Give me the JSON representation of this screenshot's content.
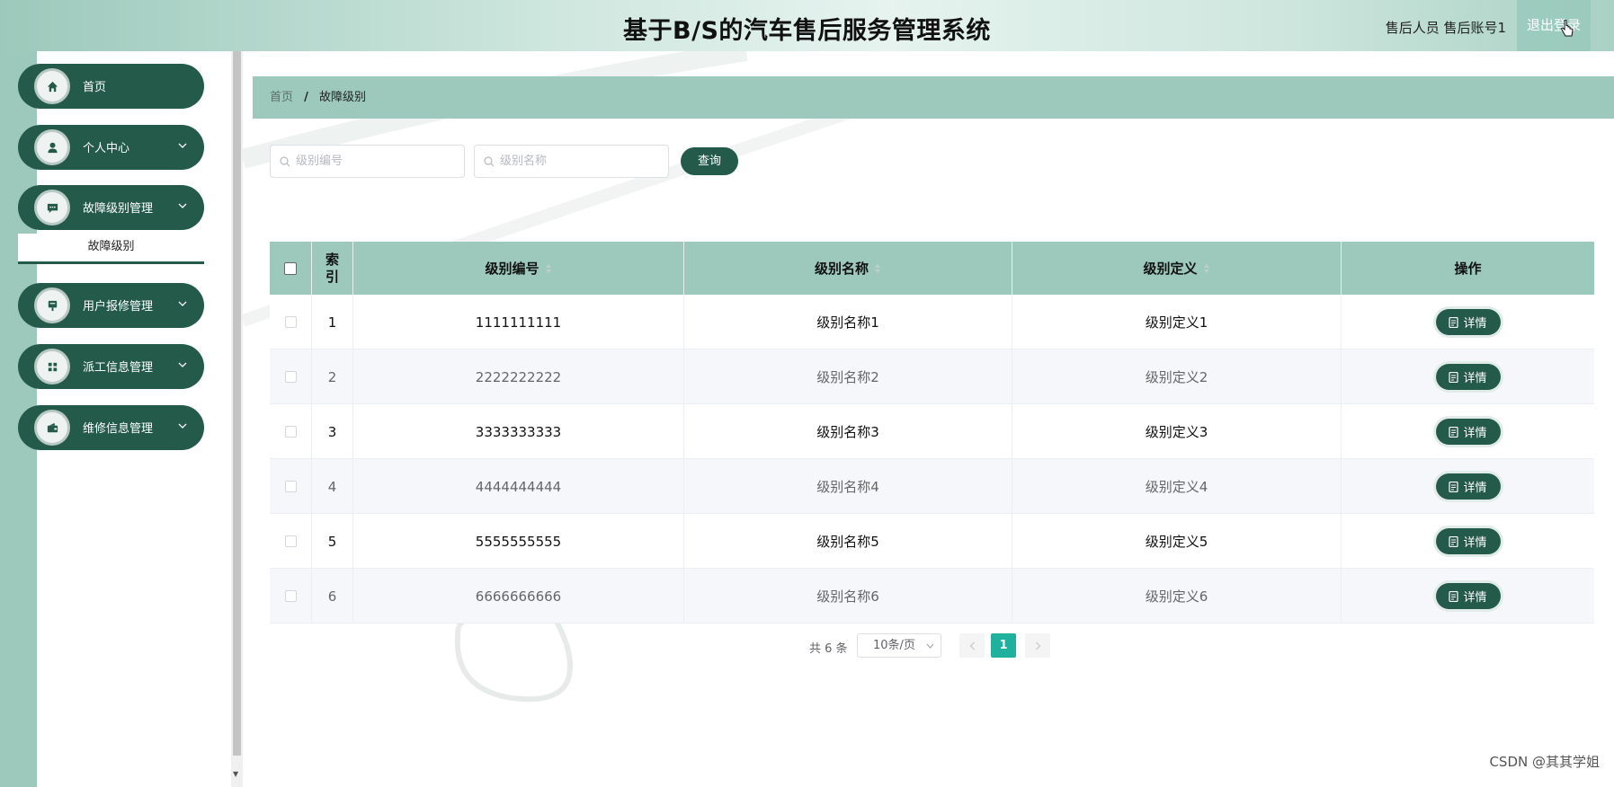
{
  "header": {
    "title": "基于B/S的汽车售后服务管理系统",
    "user": "售后人员 售后账号1",
    "logout_label": "退出登录"
  },
  "sidebar": {
    "items": [
      {
        "label": "首页",
        "icon": "home-icon"
      },
      {
        "label": "个人中心",
        "icon": "user-icon"
      },
      {
        "label": "故障级别管理",
        "icon": "message-icon"
      },
      {
        "label": "用户报修管理",
        "icon": "post-icon"
      },
      {
        "label": "派工信息管理",
        "icon": "grid-icon"
      },
      {
        "label": "维修信息管理",
        "icon": "wallet-icon"
      }
    ],
    "submenu": "故障级别"
  },
  "breadcrumb": {
    "home": "首页",
    "separator": "/",
    "current": "故障级别"
  },
  "search": {
    "code_placeholder": "级别编号",
    "name_placeholder": "级别名称",
    "query_label": "查询"
  },
  "table": {
    "headers": {
      "index": [
        "索",
        "引"
      ],
      "code": "级别编号",
      "name": "级别名称",
      "definition": "级别定义",
      "action": "操作"
    },
    "detail_label": "详情",
    "rows": [
      {
        "index": "1",
        "code": "1111111111",
        "name": "级别名称1",
        "definition": "级别定义1"
      },
      {
        "index": "2",
        "code": "2222222222",
        "name": "级别名称2",
        "definition": "级别定义2"
      },
      {
        "index": "3",
        "code": "3333333333",
        "name": "级别名称3",
        "definition": "级别定义3"
      },
      {
        "index": "4",
        "code": "4444444444",
        "name": "级别名称4",
        "definition": "级别定义4"
      },
      {
        "index": "5",
        "code": "5555555555",
        "name": "级别名称5",
        "definition": "级别定义5"
      },
      {
        "index": "6",
        "code": "6666666666",
        "name": "级别名称6",
        "definition": "级别定义6"
      }
    ]
  },
  "pagination": {
    "total": "共 6 条",
    "page_size": "10条/页",
    "current_page": "1"
  },
  "watermark": "CSDN @其其学姐",
  "colors": {
    "primary": "#245a49",
    "accent": "#9cc9bb",
    "page_active": "#1fb19d"
  }
}
